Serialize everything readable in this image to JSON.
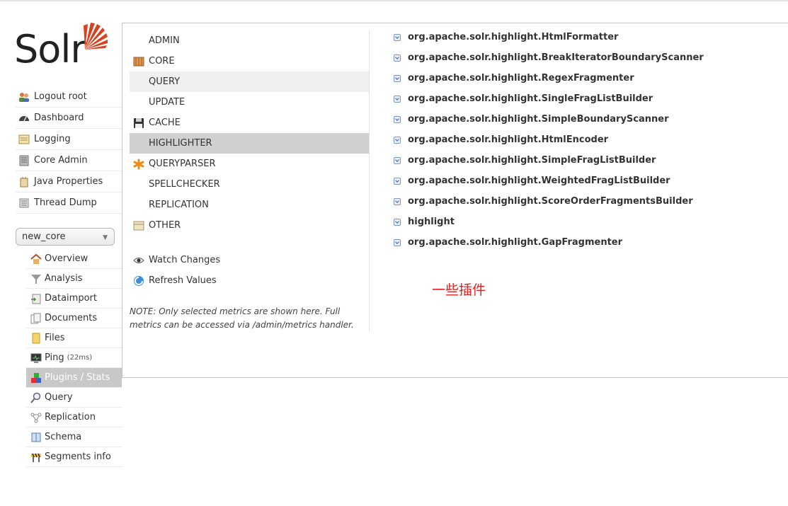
{
  "logo": {
    "text": "Solr",
    "icon": "solr-sun-icon",
    "color": "#d9411e"
  },
  "main_nav": [
    {
      "label": "Logout root",
      "icon": "users-icon"
    },
    {
      "label": "Dashboard",
      "icon": "dashboard-icon"
    },
    {
      "label": "Logging",
      "icon": "logging-icon"
    },
    {
      "label": "Core Admin",
      "icon": "core-admin-icon"
    },
    {
      "label": "Java Properties",
      "icon": "java-icon"
    },
    {
      "label": "Thread Dump",
      "icon": "thread-icon"
    }
  ],
  "core_selector": {
    "value": "new_core"
  },
  "core_nav": [
    {
      "label": "Overview",
      "icon": "home-icon"
    },
    {
      "label": "Analysis",
      "icon": "funnel-icon"
    },
    {
      "label": "Dataimport",
      "icon": "import-icon"
    },
    {
      "label": "Documents",
      "icon": "documents-icon"
    },
    {
      "label": "Files",
      "icon": "folder-icon"
    },
    {
      "label": "Ping",
      "icon": "monitor-icon",
      "extra": "(22ms)"
    },
    {
      "label": "Plugins / Stats",
      "icon": "plugins-icon",
      "active": true
    },
    {
      "label": "Query",
      "icon": "magnifier-icon"
    },
    {
      "label": "Replication",
      "icon": "replication-icon"
    },
    {
      "label": "Schema",
      "icon": "book-icon"
    },
    {
      "label": "Segments info",
      "icon": "barrier-icon"
    }
  ],
  "categories": [
    {
      "label": "ADMIN",
      "icon": ""
    },
    {
      "label": "CORE",
      "icon": "core-icon"
    },
    {
      "label": "QUERY",
      "icon": "",
      "state": "hover"
    },
    {
      "label": "UPDATE",
      "icon": ""
    },
    {
      "label": "CACHE",
      "icon": "floppy-icon"
    },
    {
      "label": "HIGHLIGHTER",
      "icon": "",
      "state": "selected"
    },
    {
      "label": "QUERYPARSER",
      "icon": "asterisk-icon"
    },
    {
      "label": "SPELLCHECKER",
      "icon": ""
    },
    {
      "label": "REPLICATION",
      "icon": ""
    },
    {
      "label": "OTHER",
      "icon": "box-icon"
    }
  ],
  "actions": {
    "watch": "Watch Changes",
    "refresh": "Refresh Values"
  },
  "note": "NOTE: Only selected metrics are shown here. Full metrics can be accessed via /admin/metrics handler.",
  "plugins": [
    "org.apache.solr.highlight.HtmlFormatter",
    "org.apache.solr.highlight.BreakIteratorBoundaryScanner",
    "org.apache.solr.highlight.RegexFragmenter",
    "org.apache.solr.highlight.SingleFragListBuilder",
    "org.apache.solr.highlight.SimpleBoundaryScanner",
    "org.apache.solr.highlight.HtmlEncoder",
    "org.apache.solr.highlight.SimpleFragListBuilder",
    "org.apache.solr.highlight.WeightedFragListBuilder",
    "org.apache.solr.highlight.ScoreOrderFragmentsBuilder",
    "highlight",
    "org.apache.solr.highlight.GapFragmenter"
  ],
  "annotation": "一些插件"
}
